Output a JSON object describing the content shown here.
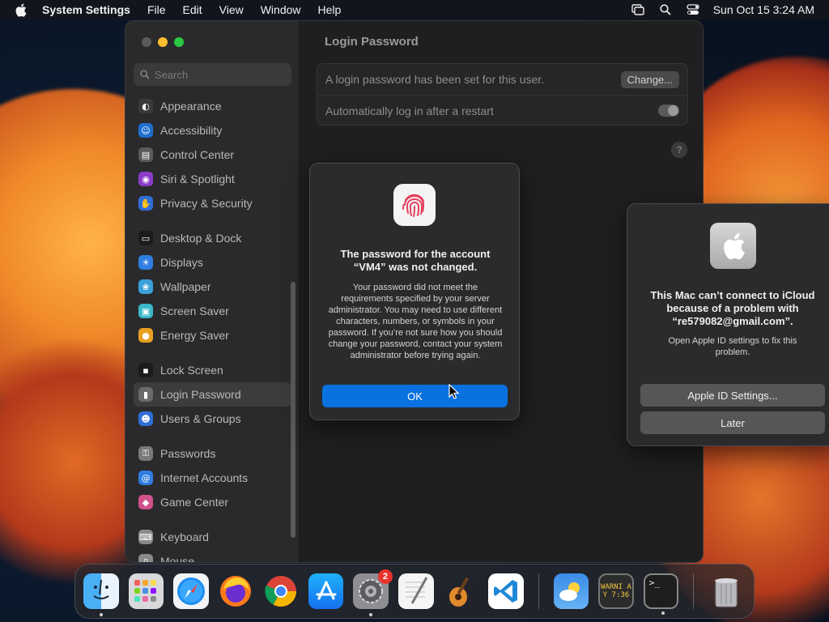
{
  "menubar": {
    "app_name": "System Settings",
    "menus": [
      "File",
      "Edit",
      "View",
      "Window",
      "Help"
    ],
    "datetime": "Sun Oct 15  3:24 AM"
  },
  "sidebar": {
    "search_placeholder": "Search",
    "groups": [
      [
        {
          "label": "Appearance",
          "icon": "appearance-icon",
          "color": "#3a3a3c"
        },
        {
          "label": "Accessibility",
          "icon": "accessibility-icon",
          "color": "#1f6fd0"
        },
        {
          "label": "Control Center",
          "icon": "control-center-icon",
          "color": "#5a5a5c"
        },
        {
          "label": "Siri & Spotlight",
          "icon": "siri-icon",
          "color": "#8a3cc8"
        },
        {
          "label": "Privacy & Security",
          "icon": "privacy-icon",
          "color": "#2f6ed6"
        }
      ],
      [
        {
          "label": "Desktop & Dock",
          "icon": "desktop-dock-icon",
          "color": "#1c1c1e"
        },
        {
          "label": "Displays",
          "icon": "displays-icon",
          "color": "#2f7de0"
        },
        {
          "label": "Wallpaper",
          "icon": "wallpaper-icon",
          "color": "#3aa0d8"
        },
        {
          "label": "Screen Saver",
          "icon": "screen-saver-icon",
          "color": "#3ab8c8"
        },
        {
          "label": "Energy Saver",
          "icon": "energy-saver-icon",
          "color": "#e8a020"
        }
      ],
      [
        {
          "label": "Lock Screen",
          "icon": "lock-screen-icon",
          "color": "#1c1c1e"
        },
        {
          "label": "Login Password",
          "icon": "login-password-icon",
          "color": "#6a6a6c",
          "selected": true
        },
        {
          "label": "Users & Groups",
          "icon": "users-groups-icon",
          "color": "#2f6ed6"
        }
      ],
      [
        {
          "label": "Passwords",
          "icon": "passwords-icon",
          "color": "#7a7a7c"
        },
        {
          "label": "Internet Accounts",
          "icon": "internet-accounts-icon",
          "color": "#2f7de0"
        },
        {
          "label": "Game Center",
          "icon": "game-center-icon",
          "color": "#d0508a"
        }
      ],
      [
        {
          "label": "Keyboard",
          "icon": "keyboard-icon",
          "color": "#8a8a8c"
        },
        {
          "label": "Mouse",
          "icon": "mouse-icon",
          "color": "#8a8a8c"
        }
      ]
    ]
  },
  "content": {
    "title": "Login Password",
    "row1_text": "A login password has been set for this user.",
    "change_label": "Change...",
    "row2_text": "Automatically log in after a restart",
    "help_label": "?"
  },
  "password_dialog": {
    "title": "The password for the account “VM4” was not changed.",
    "body": "Your password did not meet the requirements specified by your server administrator. You may need to use different characters, numbers, or symbols in your password. If you’re not sure how you should change your password, contact your system administrator before trying again.",
    "ok_label": "OK"
  },
  "icloud_dialog": {
    "title": "This Mac can’t connect to iCloud because of a problem with “re579082@gmail.com”.",
    "body": "Open Apple ID settings to fix this problem.",
    "primary_label": "Apple ID Settings...",
    "secondary_label": "Later"
  },
  "dock": {
    "settings_badge": "2",
    "console_text": "WARNI AY 7:36",
    "terminal_text": ">_"
  },
  "colors": {
    "accent": "#0a72e0",
    "badge": "#e8332b"
  }
}
